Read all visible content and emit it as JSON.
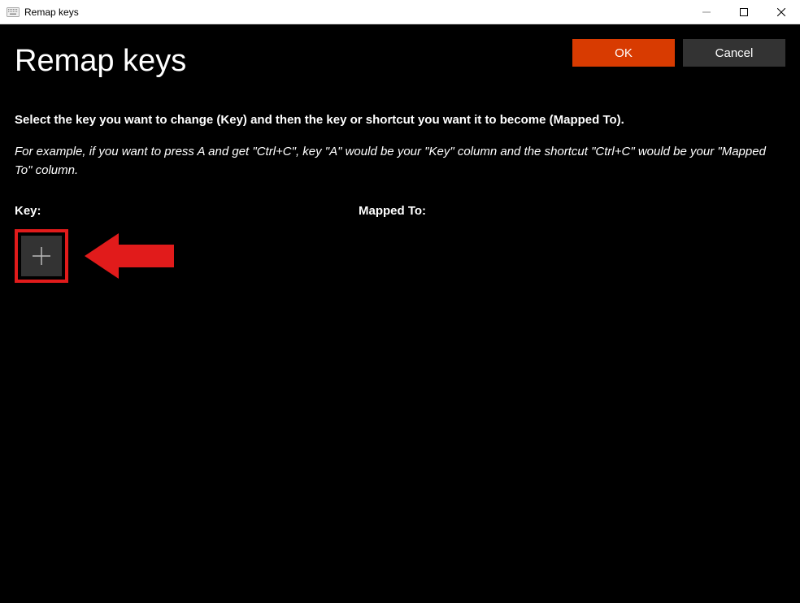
{
  "window": {
    "title": "Remap keys"
  },
  "header": {
    "page_title": "Remap keys",
    "ok_label": "OK",
    "cancel_label": "Cancel"
  },
  "instructions": {
    "bold": "Select the key you want to change (Key) and then the key or shortcut you want it to become (Mapped To).",
    "italic": "For example, if you want to press A and get \"Ctrl+C\", key \"A\" would be your \"Key\" column and the shortcut \"Ctrl+C\" would be your \"Mapped To\" column."
  },
  "columns": {
    "key_label": "Key:",
    "mapped_label": "Mapped To:"
  },
  "colors": {
    "accent": "#d83b01",
    "annotation": "#e11b1b",
    "button_dark": "#333333"
  }
}
